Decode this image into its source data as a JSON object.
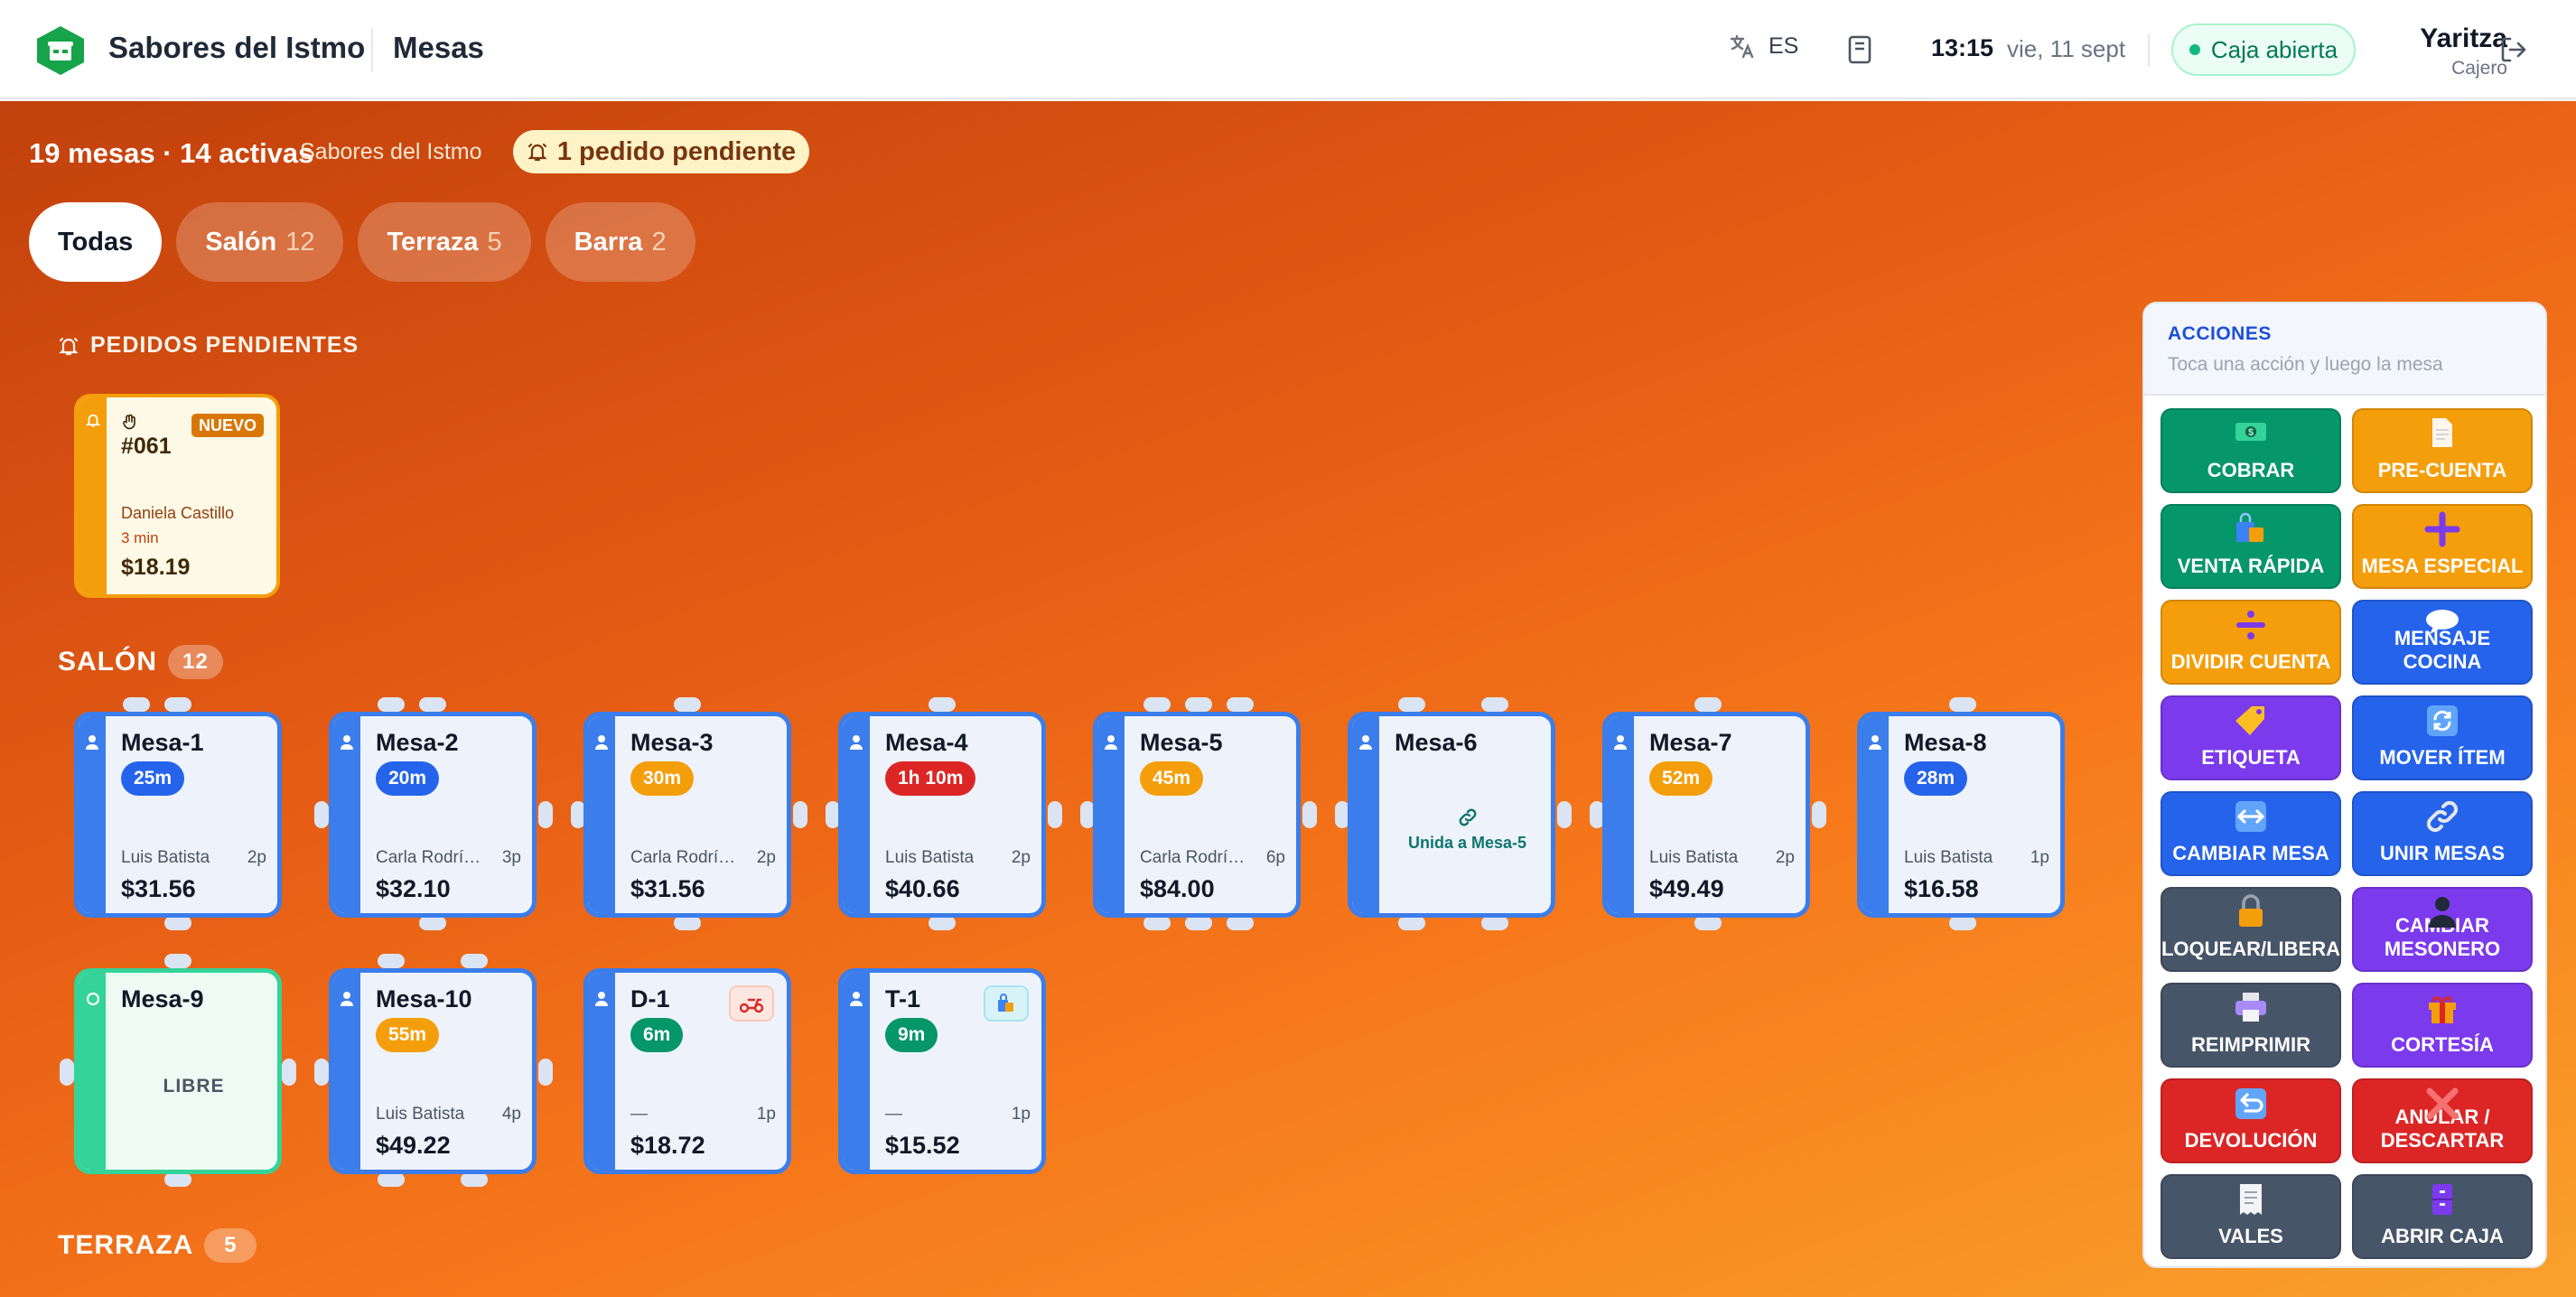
{
  "header": {
    "brand": "Sabores del Istmo",
    "page_title": "Mesas",
    "lang": "ES",
    "time": "13:15",
    "date": "vie, 11 sept",
    "register_status": "Caja abierta",
    "user_name": "Yaritza",
    "user_role": "Cajero"
  },
  "summary": {
    "counts": "19 mesas · 14 activas",
    "venue": "Sabores del Istmo",
    "pending": "1 pedido pendiente"
  },
  "filters": [
    {
      "label": "Todas",
      "count": ""
    },
    {
      "label": "Salón",
      "count": "12"
    },
    {
      "label": "Terraza",
      "count": "5"
    },
    {
      "label": "Barra",
      "count": "2"
    }
  ],
  "pending_section": {
    "title": "PEDIDOS PENDIENTES",
    "order": {
      "badge": "NUEVO",
      "number": "#061",
      "customer": "Daniela Castillo",
      "elapsed": "3 min",
      "total": "$18.19"
    }
  },
  "salon": {
    "title": "SALÓN",
    "count": "12",
    "tables": [
      {
        "name": "Mesa-1",
        "timer": "25m",
        "waiter": "Luis Batista",
        "people": "2p",
        "total": "$31.56"
      },
      {
        "name": "Mesa-2",
        "timer": "20m",
        "waiter": "Carla Rodríguez",
        "people": "3p",
        "total": "$32.10"
      },
      {
        "name": "Mesa-3",
        "timer": "30m",
        "waiter": "Carla Rodríguez",
        "people": "2p",
        "total": "$31.56"
      },
      {
        "name": "Mesa-4",
        "timer": "1h 10m",
        "waiter": "Luis Batista",
        "people": "2p",
        "total": "$40.66"
      },
      {
        "name": "Mesa-5",
        "timer": "45m",
        "waiter": "Carla Rodríguez",
        "people": "6p",
        "total": "$84.00"
      },
      {
        "name": "Mesa-6",
        "joined": "Unida a Mesa-5"
      },
      {
        "name": "Mesa-7",
        "timer": "52m",
        "waiter": "Luis Batista",
        "people": "2p",
        "total": "$49.49"
      },
      {
        "name": "Mesa-8",
        "timer": "28m",
        "waiter": "Luis Batista",
        "people": "1p",
        "total": "$16.58"
      },
      {
        "name": "Mesa-9",
        "status": "LIBRE"
      },
      {
        "name": "Mesa-10",
        "timer": "55m",
        "waiter": "Luis Batista",
        "people": "4p",
        "total": "$49.22"
      },
      {
        "name": "D-1",
        "timer": "6m",
        "waiter": "—",
        "people": "1p",
        "total": "$18.72"
      },
      {
        "name": "T-1",
        "timer": "9m",
        "waiter": "—",
        "people": "1p",
        "total": "$15.52"
      }
    ]
  },
  "terraza": {
    "title": "TERRAZA",
    "count": "5"
  },
  "actions": {
    "title": "ACCIONES",
    "subtitle": "Toca una acción y luego la mesa",
    "buttons": [
      {
        "label": "COBRAR",
        "icon": "money-icon"
      },
      {
        "label": "PRE-CUENTA",
        "icon": "document-icon"
      },
      {
        "label": "VENTA RÁPIDA",
        "icon": "shopping-bags-icon"
      },
      {
        "label": "MESA ESPECIAL",
        "icon": "plus-icon"
      },
      {
        "label": "DIVIDIR CUENTA",
        "icon": "divide-icon"
      },
      {
        "label": "MENSAJE COCINA",
        "icon": "speech-bubble-icon"
      },
      {
        "label": "ETIQUETA",
        "icon": "tag-icon"
      },
      {
        "label": "MOVER ÍTEM",
        "icon": "refresh-icon"
      },
      {
        "label": "CAMBIAR MESA",
        "icon": "left-right-arrow-icon"
      },
      {
        "label": "UNIR MESAS",
        "icon": "link-icon"
      },
      {
        "label": "BLOQUEAR/LIBERAR",
        "icon": "lock-icon"
      },
      {
        "label": "CAMBIAR MESONERO",
        "icon": "person-icon"
      },
      {
        "label": "REIMPRIMIR",
        "icon": "printer-icon"
      },
      {
        "label": "CORTESÍA",
        "icon": "gift-icon"
      },
      {
        "label": "DEVOLUCIÓN",
        "icon": "return-arrow-icon"
      },
      {
        "label": "ANULAR / DESCARTAR",
        "icon": "cross-mark-icon"
      },
      {
        "label": "VALES",
        "icon": "receipt-icon"
      },
      {
        "label": "ABRIR CAJA",
        "icon": "file-cabinet-icon"
      }
    ]
  },
  "colors": {
    "brand_green": "#10b981",
    "table_blue": "#3b7dea",
    "libre_green": "#34d399",
    "timer_blue": "#2563eb",
    "timer_amber": "#f59e0b",
    "timer_red": "#dc2626",
    "timer_green": "#059669",
    "pending_amber": "#f59e0b"
  }
}
